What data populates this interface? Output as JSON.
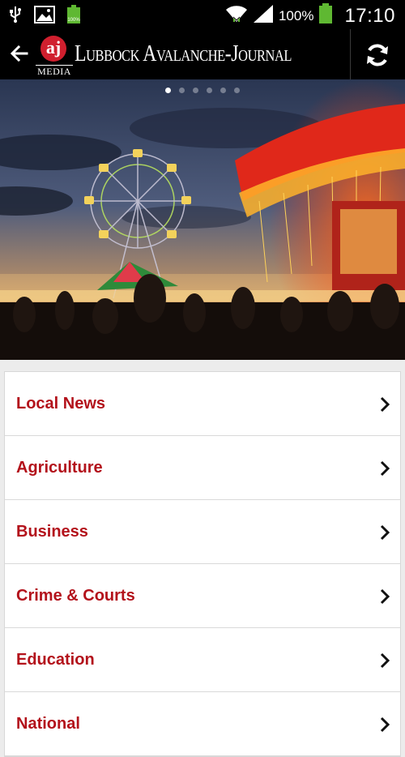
{
  "status_bar": {
    "battery_pct": "100%",
    "time": "17:10",
    "icons": [
      "usb-icon",
      "image-icon",
      "battery-small-icon",
      "wifi-icon",
      "signal-icon",
      "battery-icon"
    ]
  },
  "app_bar": {
    "logo_letters": "aj",
    "logo_sub": "MEDIA",
    "title": "Lubbock Avalanche-Journal",
    "icons": [
      "back-arrow-icon",
      "refresh-icon"
    ]
  },
  "hero": {
    "pager_count": 6,
    "pager_active": 0
  },
  "sections": [
    {
      "label": "Local News"
    },
    {
      "label": "Agriculture"
    },
    {
      "label": "Business"
    },
    {
      "label": "Crime & Courts"
    },
    {
      "label": "Education"
    },
    {
      "label": "National"
    }
  ],
  "colors": {
    "accent": "#b3121b",
    "bar": "#000000",
    "logo_red": "#d01f2e"
  }
}
